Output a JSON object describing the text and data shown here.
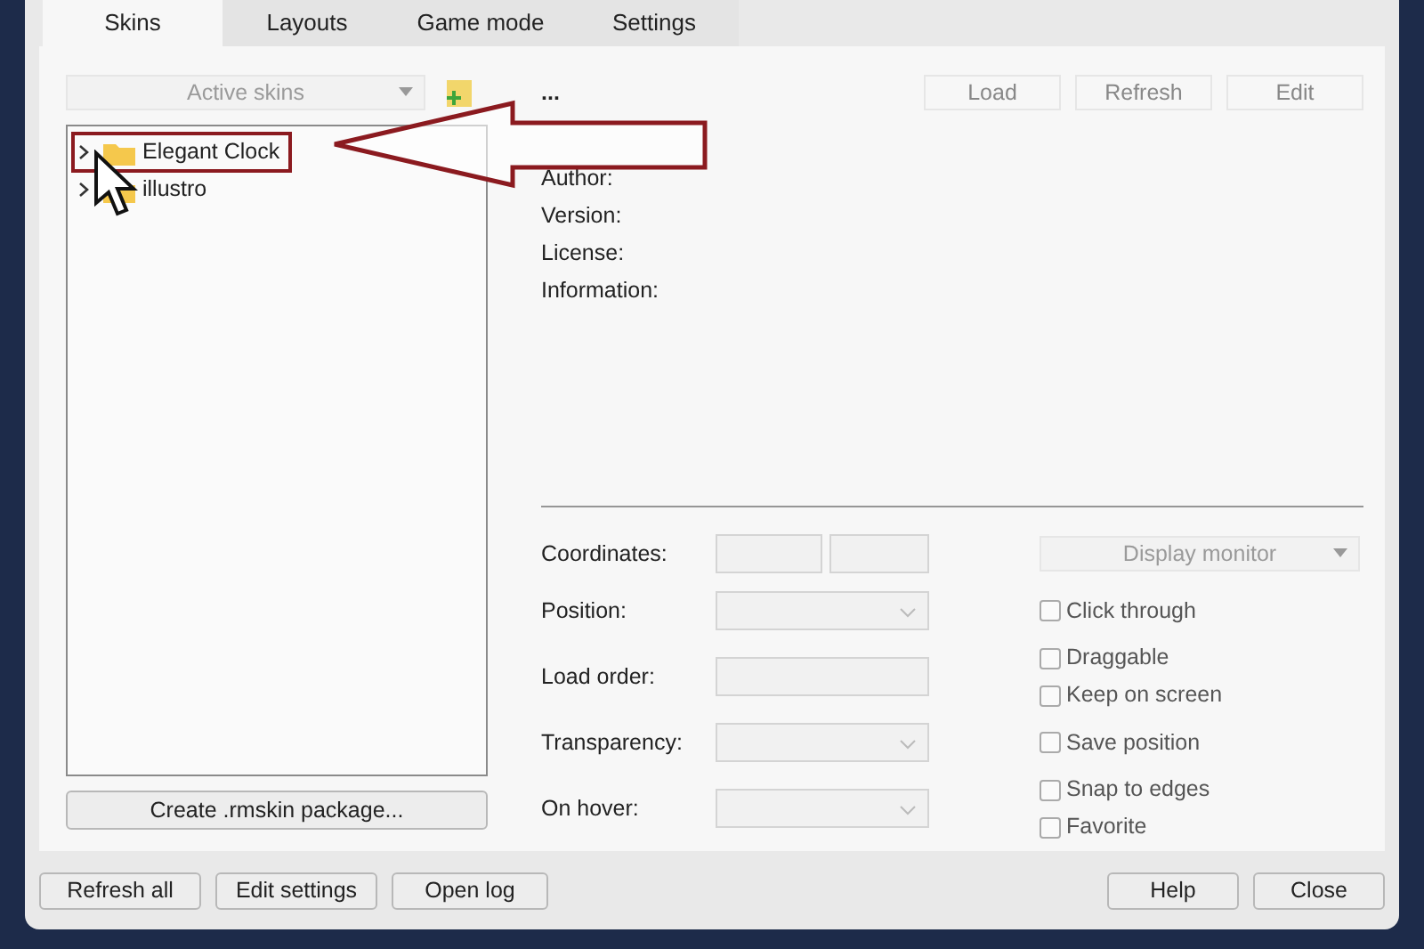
{
  "tabs": [
    {
      "label": "Skins",
      "selected": true
    },
    {
      "label": "Layouts",
      "selected": false
    },
    {
      "label": "Game mode",
      "selected": false
    },
    {
      "label": "Settings",
      "selected": false
    }
  ],
  "skins_dropdown": {
    "placeholder": "Active skins"
  },
  "tree": [
    {
      "label": "Elegant Clock",
      "expanded": false,
      "highlighted": true
    },
    {
      "label": "illustro",
      "expanded": false,
      "highlighted": false
    }
  ],
  "create_button": "Create .rmskin package...",
  "skin_name": "...",
  "skin_buttons": [
    "Load",
    "Refresh",
    "Edit"
  ],
  "info_labels": [
    "Author:",
    "Version:",
    "License:",
    "Information:"
  ],
  "form": [
    {
      "label": "Coordinates:",
      "kind": "pair"
    },
    {
      "label": "Position:",
      "kind": "select"
    },
    {
      "label": "Load order:",
      "kind": "text"
    },
    {
      "label": "Transparency:",
      "kind": "select"
    },
    {
      "label": "On hover:",
      "kind": "select"
    }
  ],
  "monitor_dropdown": {
    "placeholder": "Display monitor"
  },
  "options": [
    {
      "label": "Click through",
      "checked": false
    },
    {
      "label": "Draggable",
      "checked": false
    },
    {
      "label": "Keep on screen",
      "checked": false
    },
    {
      "label": "Save position",
      "checked": false
    },
    {
      "label": "Snap to edges",
      "checked": false
    },
    {
      "label": "Favorite",
      "checked": false
    }
  ],
  "left_buttons": [
    "Refresh all",
    "Edit settings",
    "Open log"
  ],
  "right_buttons": [
    "Help",
    "Close"
  ]
}
